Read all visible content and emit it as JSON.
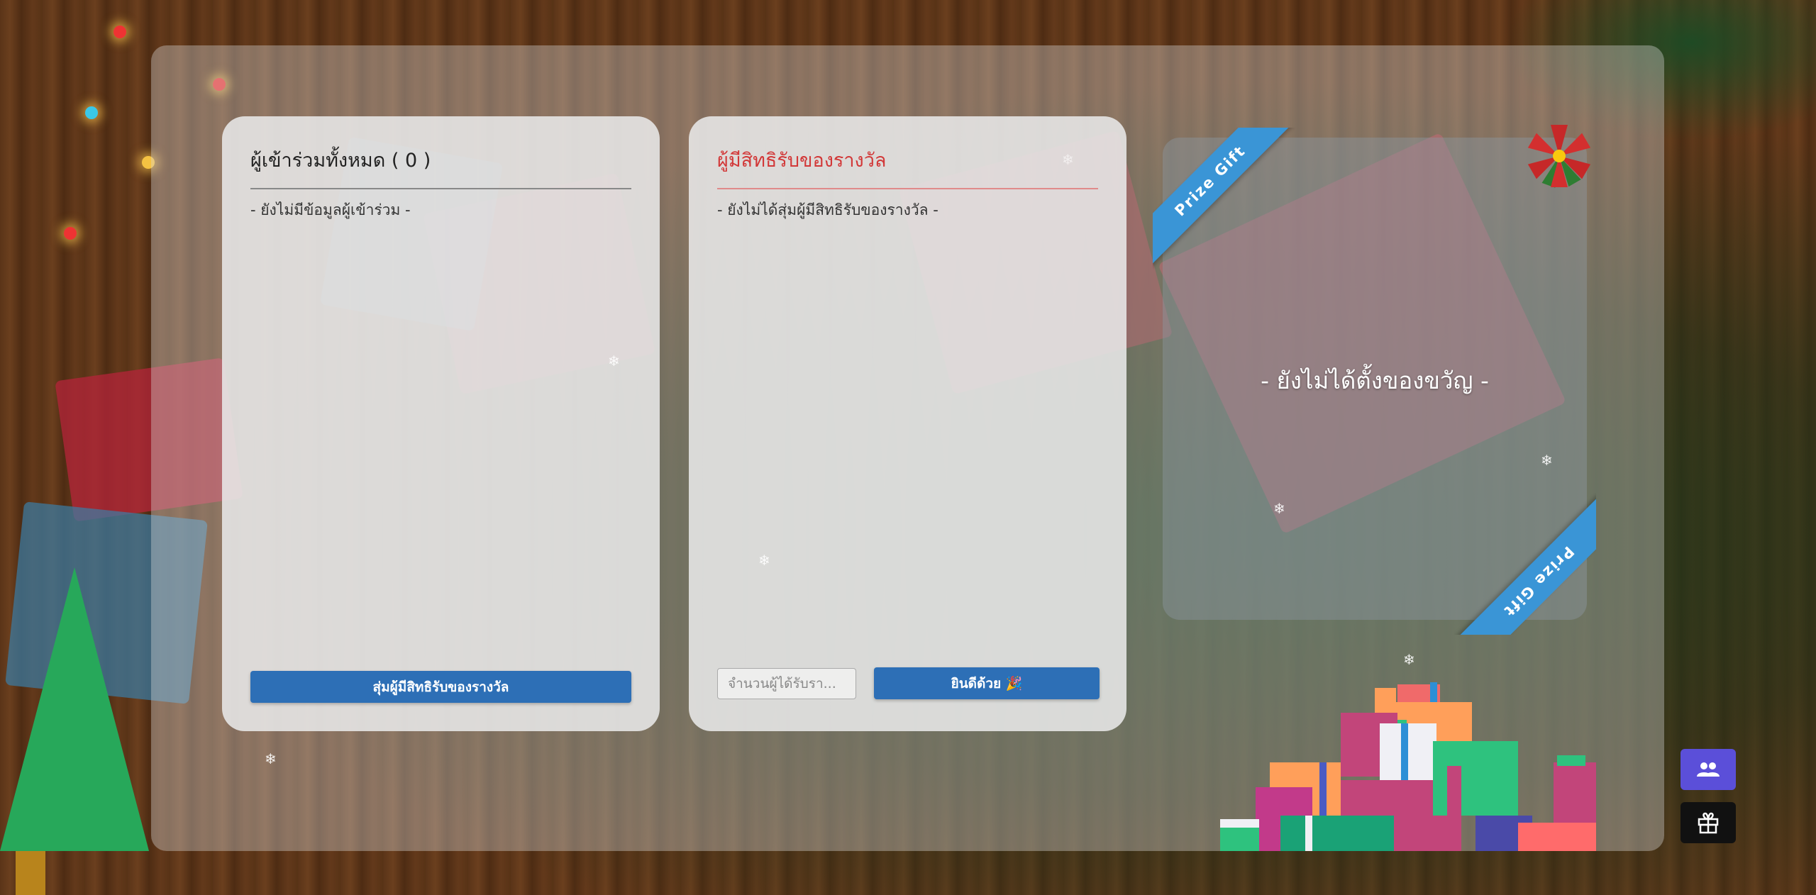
{
  "participants": {
    "title": "ผู้เข้าร่วมทั้งหมด ( 0 )",
    "empty_text": "- ยังไม่มีข้อมูลผู้เข้าร่วม -",
    "random_button": "สุ่มผู้มีสิทธิรับของรางวัล"
  },
  "winners": {
    "title": "ผู้มีสิทธิรับของรางวัล",
    "empty_text": "- ยังไม่ได้สุ่มผู้มีสิทธิรับของรางวัล -",
    "count_placeholder": "จำนวนผู้ได้รับรา...",
    "congrats_button": "ยินดีด้วย 🎉"
  },
  "prize": {
    "ribbon_label": "Prize Gift",
    "empty_text": "- ยังไม่ได้ตั้งของขวัญ -"
  },
  "fabs": [
    {
      "icon": "users-icon",
      "color": "#5b4fd9"
    },
    {
      "icon": "gift-icon",
      "color": "#111111"
    }
  ],
  "colors": {
    "accent_blue": "#2d6fb6",
    "ribbon_blue": "#3a95d6",
    "winner_title_red": "#d23838"
  }
}
